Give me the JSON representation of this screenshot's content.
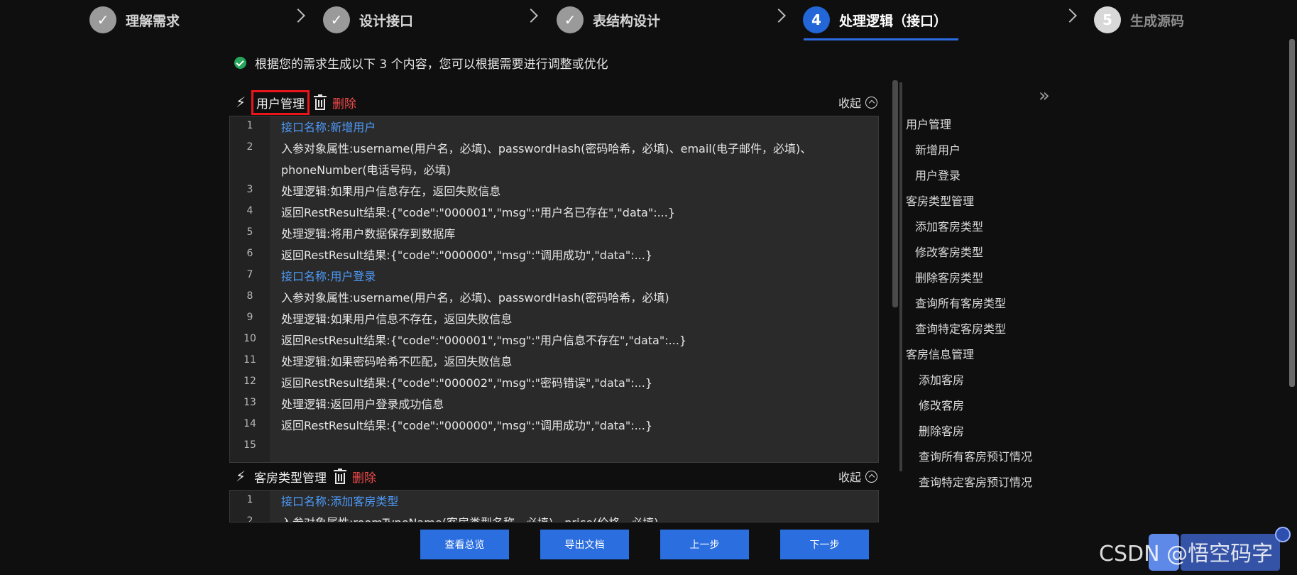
{
  "steps": [
    {
      "label": "理解需求",
      "state": "done",
      "mark": "✓"
    },
    {
      "label": "设计接口",
      "state": "done",
      "mark": "✓"
    },
    {
      "label": "表结构设计",
      "state": "done",
      "mark": "✓"
    },
    {
      "label": "处理逻辑（接口）",
      "state": "active",
      "mark": "4"
    },
    {
      "label": "生成源码",
      "state": "pending",
      "mark": "5"
    }
  ],
  "info": "根据您的需求生成以下 3 个内容，您可以根据需要进行调整或优化",
  "section1": {
    "title": "用户管理",
    "delete": "删除",
    "collapse": "收起",
    "lines": [
      {
        "n": "1",
        "text": "接口名称:新增用户",
        "blue": true
      },
      {
        "n": "2",
        "text": "入参对象属性:username(用户名，必填)、passwordHash(密码哈希，必填)、email(电子邮件，必填)、",
        "blue": false
      },
      {
        "n": "",
        "text": "phoneNumber(电话号码，必填)",
        "blue": false
      },
      {
        "n": "3",
        "text": "处理逻辑:如果用户信息存在，返回失败信息",
        "blue": false
      },
      {
        "n": "4",
        "text": "返回RestResult结果:{\"code\":\"000001\",\"msg\":\"用户名已存在\",\"data\":...}",
        "blue": false
      },
      {
        "n": "5",
        "text": "处理逻辑:将用户数据保存到数据库",
        "blue": false
      },
      {
        "n": "6",
        "text": "返回RestResult结果:{\"code\":\"000000\",\"msg\":\"调用成功\",\"data\":...}",
        "blue": false
      },
      {
        "n": "7",
        "text": "接口名称:用户登录",
        "blue": true
      },
      {
        "n": "8",
        "text": "入参对象属性:username(用户名，必填)、passwordHash(密码哈希，必填)",
        "blue": false
      },
      {
        "n": "9",
        "text": "处理逻辑:如果用户信息不存在，返回失败信息",
        "blue": false
      },
      {
        "n": "10",
        "text": "返回RestResult结果:{\"code\":\"000001\",\"msg\":\"用户信息不存在\",\"data\":...}",
        "blue": false
      },
      {
        "n": "11",
        "text": "处理逻辑:如果密码哈希不匹配，返回失败信息",
        "blue": false
      },
      {
        "n": "12",
        "text": "返回RestResult结果:{\"code\":\"000002\",\"msg\":\"密码错误\",\"data\":...}",
        "blue": false
      },
      {
        "n": "13",
        "text": "处理逻辑:返回用户登录成功信息",
        "blue": false
      },
      {
        "n": "14",
        "text": "返回RestResult结果:{\"code\":\"000000\",\"msg\":\"调用成功\",\"data\":...}",
        "blue": false
      },
      {
        "n": "15",
        "text": "",
        "blue": false
      }
    ]
  },
  "section2": {
    "title": "客房类型管理",
    "delete": "删除",
    "collapse": "收起",
    "lines": [
      {
        "n": "1",
        "text": "接口名称:添加客房类型",
        "blue": true
      },
      {
        "n": "2",
        "text": "入参对象属性:roomTypeName(客房类型名称，必填)、price(价格，必填)",
        "blue": false
      }
    ]
  },
  "outline": [
    {
      "label": "用户管理",
      "level": 1
    },
    {
      "label": "新增用户",
      "level": 2
    },
    {
      "label": "用户登录",
      "level": 2
    },
    {
      "label": "客房类型管理",
      "level": 1
    },
    {
      "label": "添加客房类型",
      "level": 2
    },
    {
      "label": "修改客房类型",
      "level": 2
    },
    {
      "label": "删除客房类型",
      "level": 2
    },
    {
      "label": "查询所有客房类型",
      "level": 2
    },
    {
      "label": "查询特定客房类型",
      "level": 2
    },
    {
      "label": "客房信息管理",
      "level": 1
    },
    {
      "label": "添加客房",
      "level": 3
    },
    {
      "label": "修改客房",
      "level": 3
    },
    {
      "label": "删除客房",
      "level": 3
    },
    {
      "label": "查询所有客房预订情况",
      "level": 3
    },
    {
      "label": "查询特定客房预订情况",
      "level": 3
    }
  ],
  "buttons": {
    "overview": "查看总览",
    "export": "导出文档",
    "prev": "上一步",
    "next": "下一步"
  },
  "watermark": "CSDN @悟空码字"
}
